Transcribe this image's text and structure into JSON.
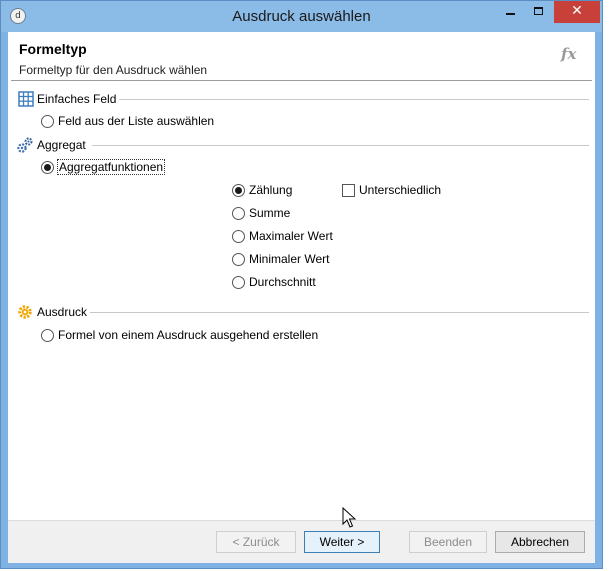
{
  "window": {
    "title": "Ausdruck auswählen",
    "app_icon_glyph": "d",
    "close_glyph": "✕"
  },
  "header": {
    "title": "Formeltyp",
    "subtitle": "Formeltyp für den Ausdruck wählen",
    "fx_label": "fx"
  },
  "groups": {
    "simple_field": {
      "label": "Einfaches Feld",
      "icon": "table-grid-icon",
      "option": "Feld aus der Liste auswählen",
      "selected": false
    },
    "aggregate": {
      "label": "Aggregat",
      "icon": "gears-icon",
      "option": "Aggregatfunktionen",
      "selected": true,
      "functions": [
        {
          "label": "Zählung",
          "selected": true
        },
        {
          "label": "Summe",
          "selected": false
        },
        {
          "label": "Maximaler Wert",
          "selected": false
        },
        {
          "label": "Minimaler Wert",
          "selected": false
        },
        {
          "label": "Durchschnitt",
          "selected": false
        }
      ],
      "distinct_label": "Unterschiedlich",
      "distinct_checked": false
    },
    "expression": {
      "label": "Ausdruck",
      "icon": "sun-gear-icon",
      "option": "Formel von einem Ausdruck ausgehend erstellen",
      "selected": false
    }
  },
  "footer": {
    "back": "< Zurück",
    "next": "Weiter >",
    "finish": "Beenden",
    "cancel": "Abbrechen"
  },
  "colors": {
    "title_bar": "#8bbbe7",
    "close_button": "#c7413a",
    "simple_field_icon": "#3f7fbf",
    "aggregate_icon": "#3a6fb0",
    "expression_icon": "#f0a500"
  }
}
